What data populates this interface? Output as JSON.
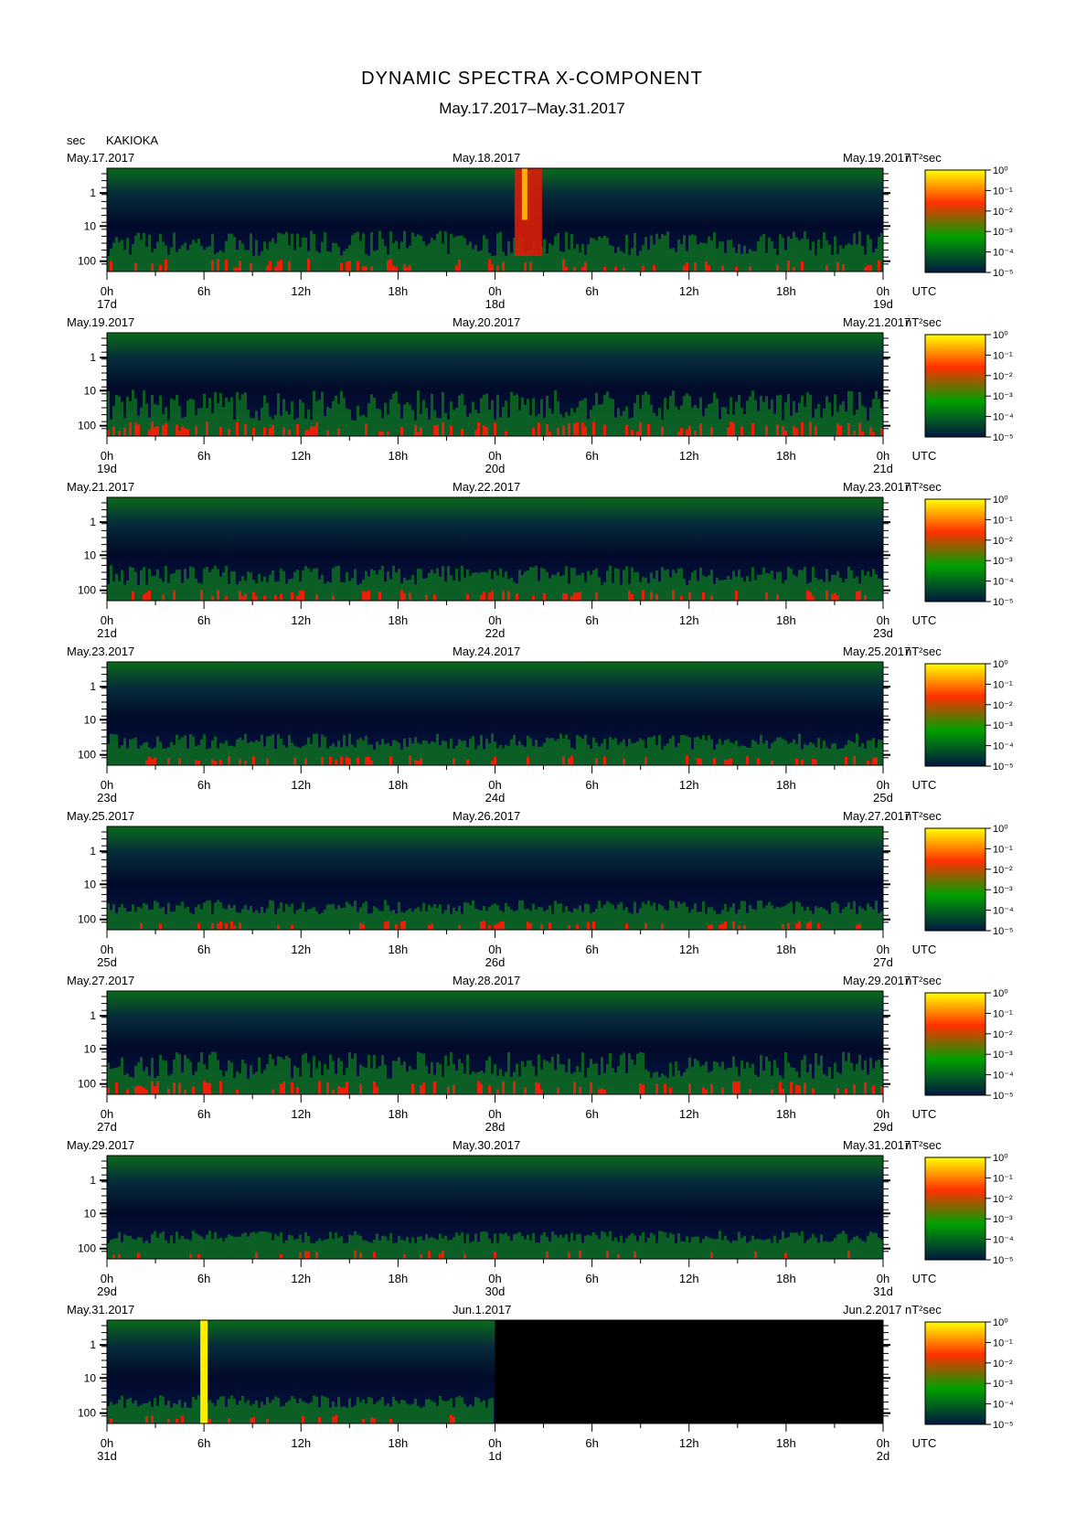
{
  "chart_data": {
    "type": "heatmap",
    "title": "DYNAMIC SPECTRA X-COMPONENT",
    "subtitle": "May.17.2017–May.31.2017",
    "ylabel": "sec",
    "station": "KAKIOKA",
    "units": "nT²sec",
    "utc_label": "UTC",
    "x_tick_labels": [
      "0h",
      "6h",
      "12h",
      "18h",
      "0h",
      "6h",
      "12h",
      "18h",
      "0h"
    ],
    "y_tick_labels": [
      "1",
      "10",
      "100"
    ],
    "colorbar_labels": [
      "10⁰",
      "10⁻¹",
      "10⁻²",
      "10⁻³",
      "10⁻⁴",
      "10⁻⁵"
    ],
    "colorbar_colors": [
      "#ffff00",
      "#ff3000",
      "#00a000",
      "#001840"
    ],
    "panels": [
      {
        "date_left": "May.17.2017",
        "date_mid": "May.18.2017",
        "date_right": "May.19.2017",
        "day_left": "17d",
        "day_mid": "18d",
        "day_right": "19d",
        "activity": 0.7
      },
      {
        "date_left": "May.19.2017",
        "date_mid": "May.20.2017",
        "date_right": "May.21.2017",
        "day_left": "19d",
        "day_mid": "20d",
        "day_right": "21d",
        "activity": 0.85
      },
      {
        "date_left": "May.21.2017",
        "date_mid": "May.22.2017",
        "date_right": "May.23.2017",
        "day_left": "21d",
        "day_mid": "22d",
        "day_right": "23d",
        "activity": 0.55
      },
      {
        "date_left": "May.23.2017",
        "date_mid": "May.24.2017",
        "date_right": "May.25.2017",
        "day_left": "23d",
        "day_mid": "24d",
        "day_right": "25d",
        "activity": 0.45
      },
      {
        "date_left": "May.25.2017",
        "date_mid": "May.26.2017",
        "date_right": "May.27.2017",
        "day_left": "25d",
        "day_mid": "26d",
        "day_right": "27d",
        "activity": 0.4
      },
      {
        "date_left": "May.27.2017",
        "date_mid": "May.28.2017",
        "date_right": "May.29.2017",
        "day_left": "27d",
        "day_mid": "28d",
        "day_right": "29d",
        "activity": 0.75
      },
      {
        "date_left": "May.29.2017",
        "date_mid": "May.30.2017",
        "date_right": "May.31.2017",
        "day_left": "29d",
        "day_mid": "30d",
        "day_right": "31d",
        "activity": 0.35
      },
      {
        "date_left": "May.31.2017",
        "date_mid": "Jun.1.2017",
        "date_right": "Jun.2.2017",
        "day_left": "31d",
        "day_mid": "1d",
        "day_right": "2d",
        "activity": 0.35,
        "data_end_hour": 24
      }
    ]
  }
}
